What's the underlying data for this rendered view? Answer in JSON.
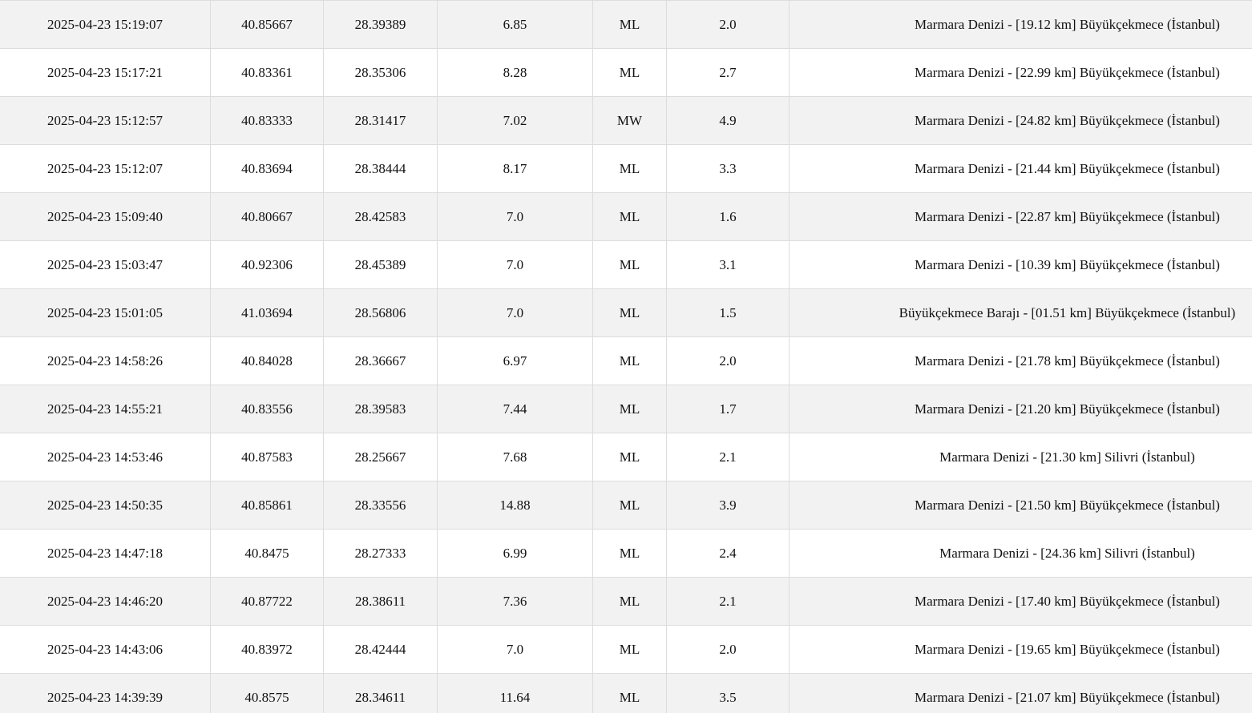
{
  "colors": {
    "row_odd": "#f2f2f2",
    "row_even": "#ffffff",
    "grid": "#dcdcdc",
    "text": "#111111"
  },
  "rows": [
    {
      "time": "2025-04-23 15:19:07",
      "lat": "40.85667",
      "lon": "28.39389",
      "depth": "6.85",
      "type": "ML",
      "mag": "2.0",
      "location": "Marmara Denizi - [19.12 km] Büyükçekmece (İstanbul)"
    },
    {
      "time": "2025-04-23 15:17:21",
      "lat": "40.83361",
      "lon": "28.35306",
      "depth": "8.28",
      "type": "ML",
      "mag": "2.7",
      "location": "Marmara Denizi - [22.99 km] Büyükçekmece (İstanbul)"
    },
    {
      "time": "2025-04-23 15:12:57",
      "lat": "40.83333",
      "lon": "28.31417",
      "depth": "7.02",
      "type": "MW",
      "mag": "4.9",
      "location": "Marmara Denizi - [24.82 km] Büyükçekmece (İstanbul)"
    },
    {
      "time": "2025-04-23 15:12:07",
      "lat": "40.83694",
      "lon": "28.38444",
      "depth": "8.17",
      "type": "ML",
      "mag": "3.3",
      "location": "Marmara Denizi - [21.44 km] Büyükçekmece (İstanbul)"
    },
    {
      "time": "2025-04-23 15:09:40",
      "lat": "40.80667",
      "lon": "28.42583",
      "depth": "7.0",
      "type": "ML",
      "mag": "1.6",
      "location": "Marmara Denizi - [22.87 km] Büyükçekmece (İstanbul)"
    },
    {
      "time": "2025-04-23 15:03:47",
      "lat": "40.92306",
      "lon": "28.45389",
      "depth": "7.0",
      "type": "ML",
      "mag": "3.1",
      "location": "Marmara Denizi - [10.39 km] Büyükçekmece (İstanbul)"
    },
    {
      "time": "2025-04-23 15:01:05",
      "lat": "41.03694",
      "lon": "28.56806",
      "depth": "7.0",
      "type": "ML",
      "mag": "1.5",
      "location": "Büyükçekmece Barajı - [01.51 km] Büyükçekmece (İstanbul)"
    },
    {
      "time": "2025-04-23 14:58:26",
      "lat": "40.84028",
      "lon": "28.36667",
      "depth": "6.97",
      "type": "ML",
      "mag": "2.0",
      "location": "Marmara Denizi - [21.78 km] Büyükçekmece (İstanbul)"
    },
    {
      "time": "2025-04-23 14:55:21",
      "lat": "40.83556",
      "lon": "28.39583",
      "depth": "7.44",
      "type": "ML",
      "mag": "1.7",
      "location": "Marmara Denizi - [21.20 km] Büyükçekmece (İstanbul)"
    },
    {
      "time": "2025-04-23 14:53:46",
      "lat": "40.87583",
      "lon": "28.25667",
      "depth": "7.68",
      "type": "ML",
      "mag": "2.1",
      "location": "Marmara Denizi - [21.30 km] Silivri (İstanbul)"
    },
    {
      "time": "2025-04-23 14:50:35",
      "lat": "40.85861",
      "lon": "28.33556",
      "depth": "14.88",
      "type": "ML",
      "mag": "3.9",
      "location": "Marmara Denizi - [21.50 km] Büyükçekmece (İstanbul)"
    },
    {
      "time": "2025-04-23 14:47:18",
      "lat": "40.8475",
      "lon": "28.27333",
      "depth": "6.99",
      "type": "ML",
      "mag": "2.4",
      "location": "Marmara Denizi - [24.36 km] Silivri (İstanbul)"
    },
    {
      "time": "2025-04-23 14:46:20",
      "lat": "40.87722",
      "lon": "28.38611",
      "depth": "7.36",
      "type": "ML",
      "mag": "2.1",
      "location": "Marmara Denizi - [17.40 km] Büyükçekmece (İstanbul)"
    },
    {
      "time": "2025-04-23 14:43:06",
      "lat": "40.83972",
      "lon": "28.42444",
      "depth": "7.0",
      "type": "ML",
      "mag": "2.0",
      "location": "Marmara Denizi - [19.65 km] Büyükçekmece (İstanbul)"
    },
    {
      "time": "2025-04-23 14:39:39",
      "lat": "40.8575",
      "lon": "28.34611",
      "depth": "11.64",
      "type": "ML",
      "mag": "3.5",
      "location": "Marmara Denizi - [21.07 km] Büyükçekmece (İstanbul)"
    }
  ]
}
